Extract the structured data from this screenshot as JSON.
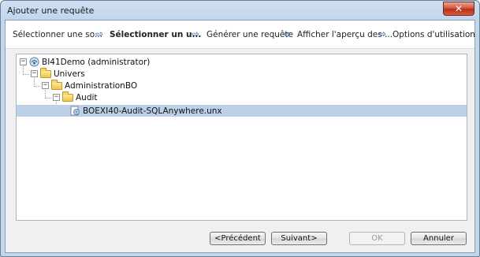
{
  "window": {
    "title": "Ajouter une requête",
    "close_glyph": "✕"
  },
  "steps": [
    {
      "label": "Sélectionner une so...",
      "active": false
    },
    {
      "label": "Sélectionner un u...",
      "active": true
    },
    {
      "label": "Générer une requête",
      "active": false
    },
    {
      "label": "Afficher l'aperçu des ...",
      "active": false
    },
    {
      "label": "Options d'utilisation",
      "active": false
    }
  ],
  "step_arrow": "⇨",
  "tree": {
    "expander_glyph": "−",
    "nodes": [
      {
        "label": "BI41Demo (administrator)",
        "icon": "server-icon"
      },
      {
        "label": "Univers",
        "icon": "folder-icon"
      },
      {
        "label": "AdministrationBO",
        "icon": "folder-icon"
      },
      {
        "label": "Audit",
        "icon": "folder-icon"
      },
      {
        "label": "BOEXI40-Audit-SQLAnywhere.unx",
        "icon": "universe-icon",
        "selected": true
      }
    ]
  },
  "buttons": {
    "previous": "<Précédent",
    "next": "Suivant>",
    "ok": "OK",
    "cancel": "Annuler"
  }
}
